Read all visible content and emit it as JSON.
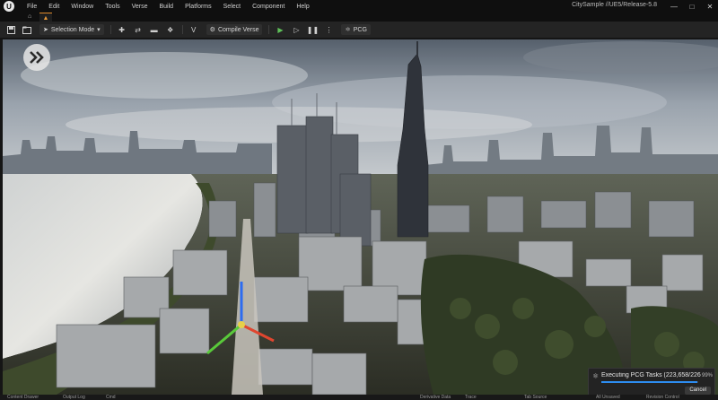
{
  "menu": {
    "items": [
      "File",
      "Edit",
      "Window",
      "Tools",
      "Verse",
      "Build",
      "Platforms",
      "Select",
      "Component",
      "Help"
    ],
    "project_title": "CitySample //UE5/Release-5.8",
    "window_controls": [
      "—",
      "□",
      "✕"
    ]
  },
  "toolbar": {
    "selection_mode": "Selection Mode",
    "compile_verse": "Compile Verse",
    "pcg": "PCG"
  },
  "statusbar": {
    "items": [
      "Content Drawer",
      "Output Log",
      "Cmd",
      "Derivative Data",
      "Trace",
      "Tab Source",
      "All Unsaved",
      "Revision Control"
    ]
  },
  "pcg_toast": {
    "text": "Executing PCG Tasks (223,658/226,0...",
    "percent": "99%",
    "progress": 0.99,
    "cancel": "Cancel"
  },
  "colors": {
    "accent_orange": "#e08a2a",
    "play_green": "#5fc15a",
    "progress_blue": "#2d8cf0"
  }
}
